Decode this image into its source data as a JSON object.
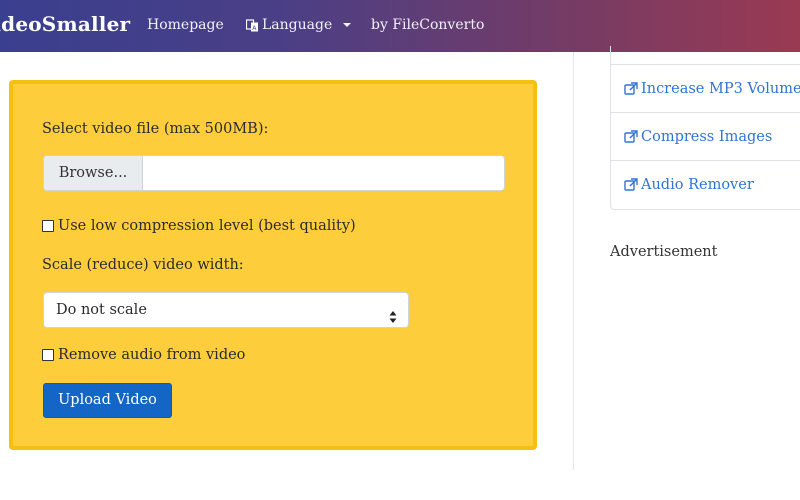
{
  "navbar": {
    "brand": "VideoSmaller",
    "links": {
      "home": "Homepage",
      "language": "Language",
      "by": "by FileConverto"
    },
    "icons": {
      "language": "translate-icon",
      "dropdown": "caret-down-icon"
    }
  },
  "form": {
    "file_label": "Select video file (max 500MB):",
    "browse_label": "Browse...",
    "file_name": "",
    "low_compression_label": "Use low compression level (best quality)",
    "low_compression_checked": false,
    "scale_label": "Scale (reduce) video width:",
    "scale_selected": "Do not scale",
    "remove_audio_label": "Remove audio from video",
    "remove_audio_checked": false,
    "upload_label": "Upload Video"
  },
  "sidebar": {
    "items": [
      {
        "label": "Increase MP3 Volume",
        "icon": "external-link-icon"
      },
      {
        "label": "Compress Images",
        "icon": "external-link-icon"
      },
      {
        "label": "Audio Remover",
        "icon": "external-link-icon"
      }
    ],
    "advertisement": "Advertisement"
  },
  "colors": {
    "navbar_start": "#3a3f8f",
    "navbar_end": "#9a3a52",
    "card_bg": "#fecd3b",
    "card_border": "#f4c012",
    "button_blue": "#1466c6",
    "link_blue": "#2f73d9"
  }
}
